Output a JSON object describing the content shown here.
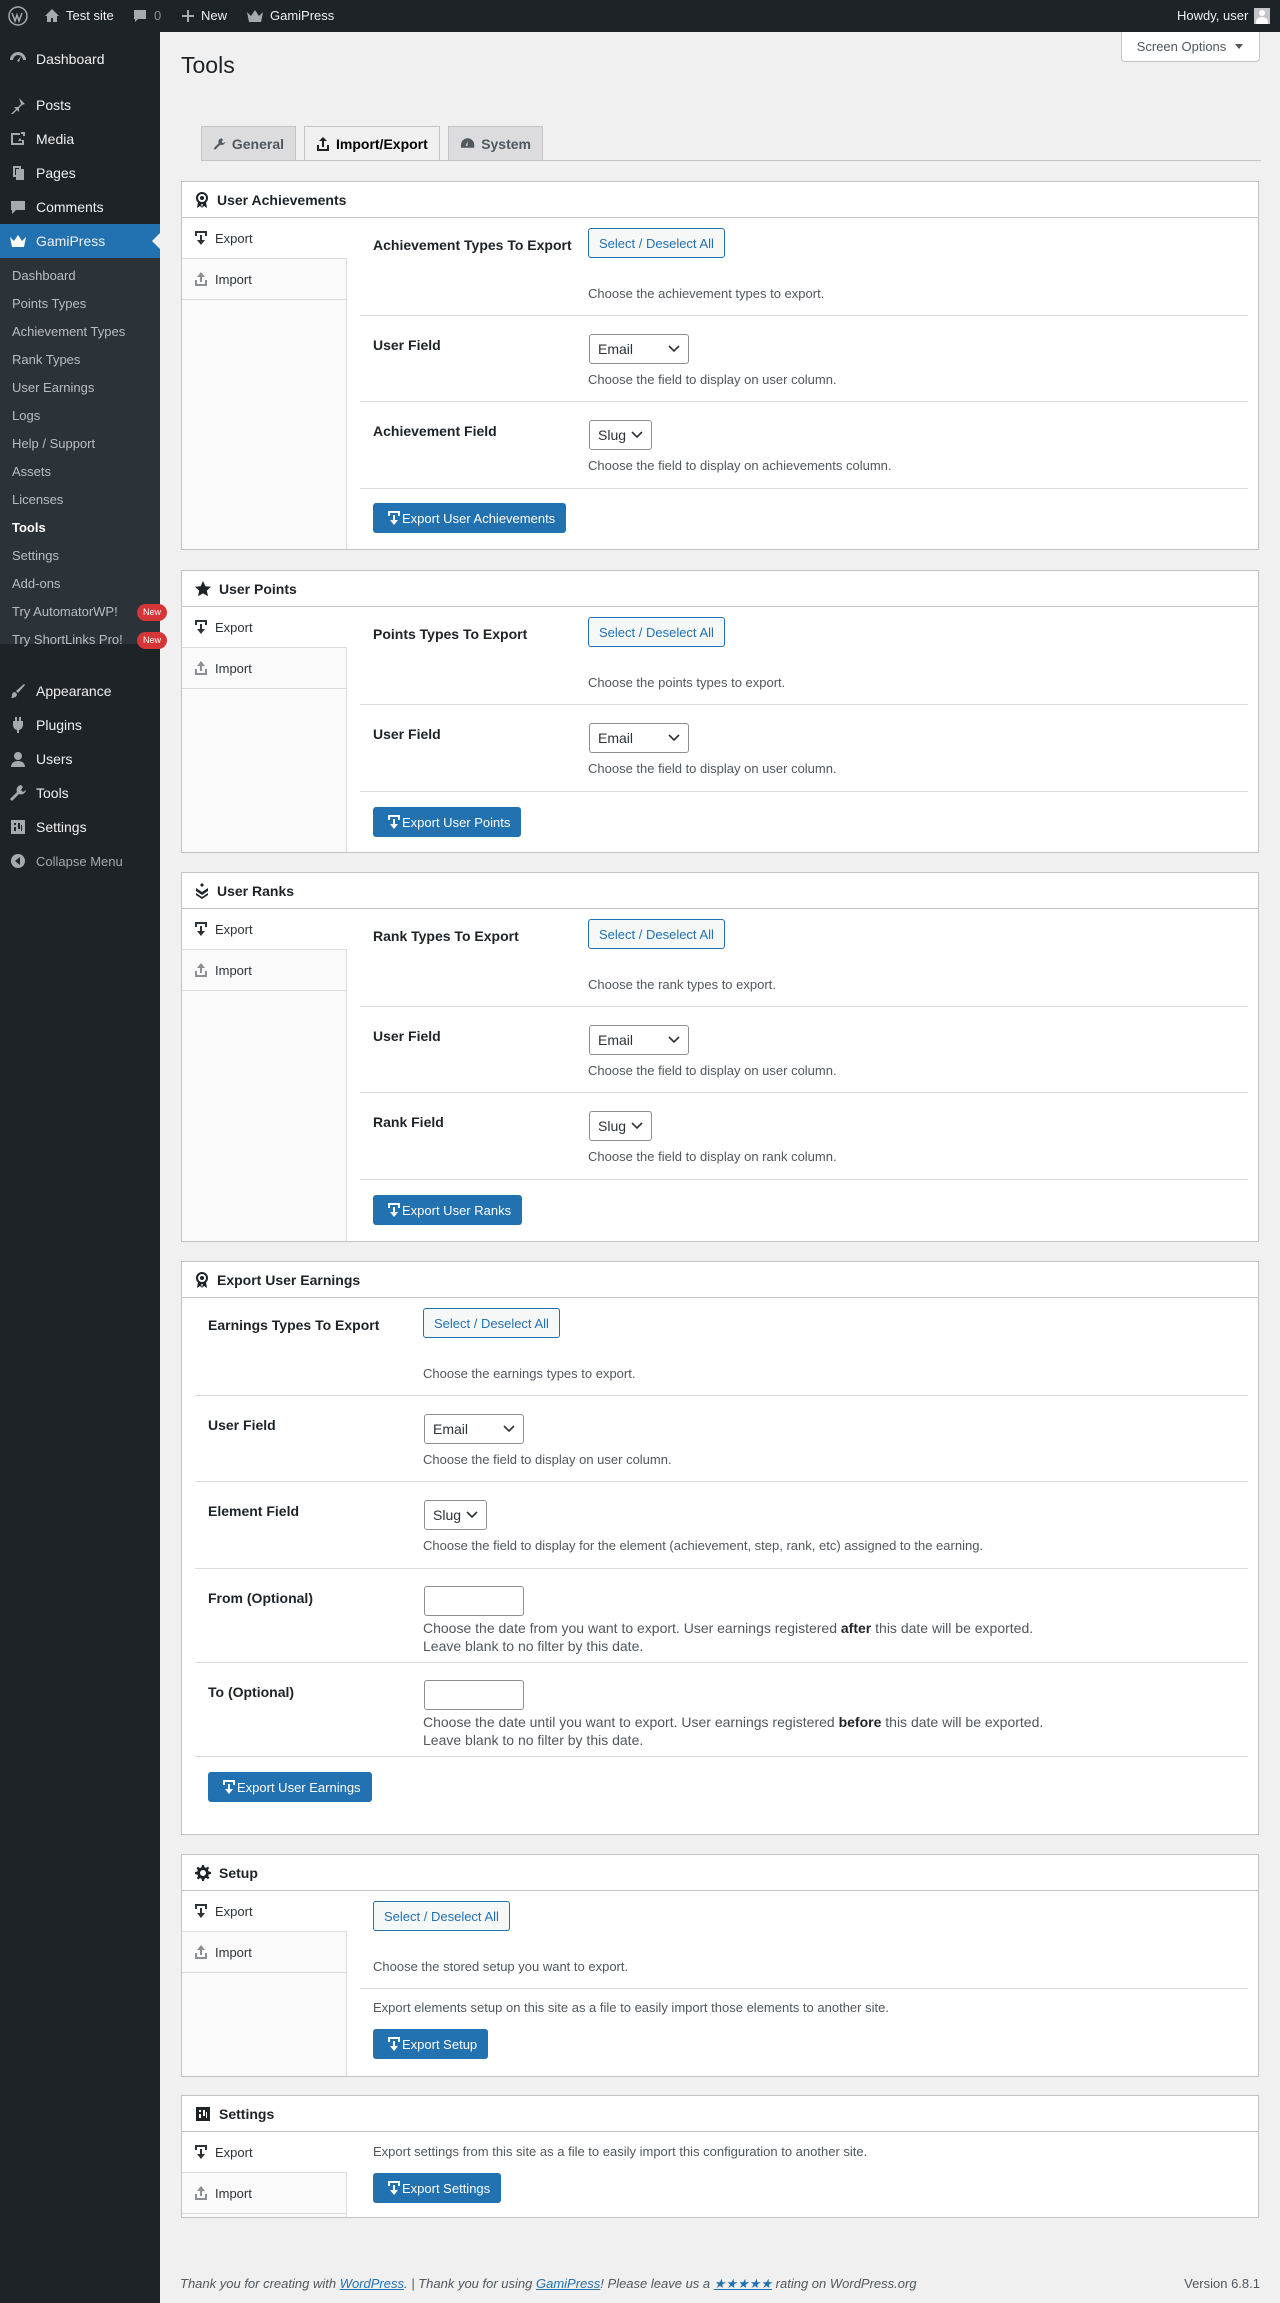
{
  "adminbar": {
    "site": "Test site",
    "comments": "0",
    "new": "New",
    "plugin": "GamiPress",
    "howdy": "Howdy, user"
  },
  "menu": {
    "dashboard": "Dashboard",
    "posts": "Posts",
    "media": "Media",
    "pages": "Pages",
    "comments": "Comments",
    "gamipress": "GamiPress",
    "appearance": "Appearance",
    "plugins": "Plugins",
    "users": "Users",
    "tools": "Tools",
    "settings": "Settings",
    "collapse": "Collapse Menu"
  },
  "submenu": [
    "Dashboard",
    "Points Types",
    "Achievement Types",
    "Rank Types",
    "User Earnings",
    "Logs",
    "Help / Support",
    "Assets",
    "Licenses",
    "Tools",
    "Settings",
    "Add-ons",
    "Try AutomatorWP!",
    "Try ShortLinks Pro!"
  ],
  "badge": "New",
  "page": {
    "title": "Tools",
    "screen_options": "Screen Options"
  },
  "tabs": [
    "General",
    "Import/Export",
    "System"
  ],
  "common": {
    "export": "Export",
    "import": "Import",
    "select_all": "Select / Deselect All",
    "email": "Email",
    "slug": "Slug",
    "user_field": "User Field",
    "user_field_desc": "Choose the field to display on user column."
  },
  "ua": {
    "title": "User Achievements",
    "types_label": "Achievement Types To Export",
    "types_desc": "Choose the achievement types to export.",
    "field_label": "Achievement Field",
    "field_desc": "Choose the field to display on achievements column.",
    "button": "Export User Achievements"
  },
  "up": {
    "title": "User Points",
    "types_label": "Points Types To Export",
    "types_desc": "Choose the points types to export.",
    "button": "Export User Points"
  },
  "ur": {
    "title": "User Ranks",
    "types_label": "Rank Types To Export",
    "types_desc": "Choose the rank types to export.",
    "field_label": "Rank Field",
    "field_desc": "Choose the field to display on rank column.",
    "button": "Export User Ranks"
  },
  "ue": {
    "title": "Export User Earnings",
    "types_label": "Earnings Types To Export",
    "types_desc": "Choose the earnings types to export.",
    "element_label": "Element Field",
    "element_desc": "Choose the field to display for the element (achievement, step, rank, etc) assigned to the earning.",
    "from_label": "From (Optional)",
    "from_desc_a": "Choose the date from you want to export. User earnings registered ",
    "from_desc_b": "after",
    "from_desc_c": " this date will be exported.",
    "to_label": "To (Optional)",
    "to_desc_a": "Choose the date until you want to export. User earnings registered ",
    "to_desc_b": "before",
    "to_desc_c": " this date will be exported.",
    "blank_desc": "Leave blank to no filter by this date.",
    "button": "Export User Earnings"
  },
  "setup": {
    "title": "Setup",
    "desc": "Choose the stored setup you want to export.",
    "desc2": "Export elements setup on this site as a file to easily import those elements to another site.",
    "button": "Export Setup"
  },
  "settings": {
    "title": "Settings",
    "desc": "Export settings from this site as a file to easily import this configuration to another site.",
    "button": "Export Settings"
  },
  "footer": {
    "a": "Thank you for creating with ",
    "wp": "WordPress",
    "b": ". | Thank you for using ",
    "gp": "GamiPress",
    "c": "! Please leave us a ",
    "stars": "★★★★★",
    "d": " rating on WordPress.org",
    "version": "Version 6.8.1"
  }
}
